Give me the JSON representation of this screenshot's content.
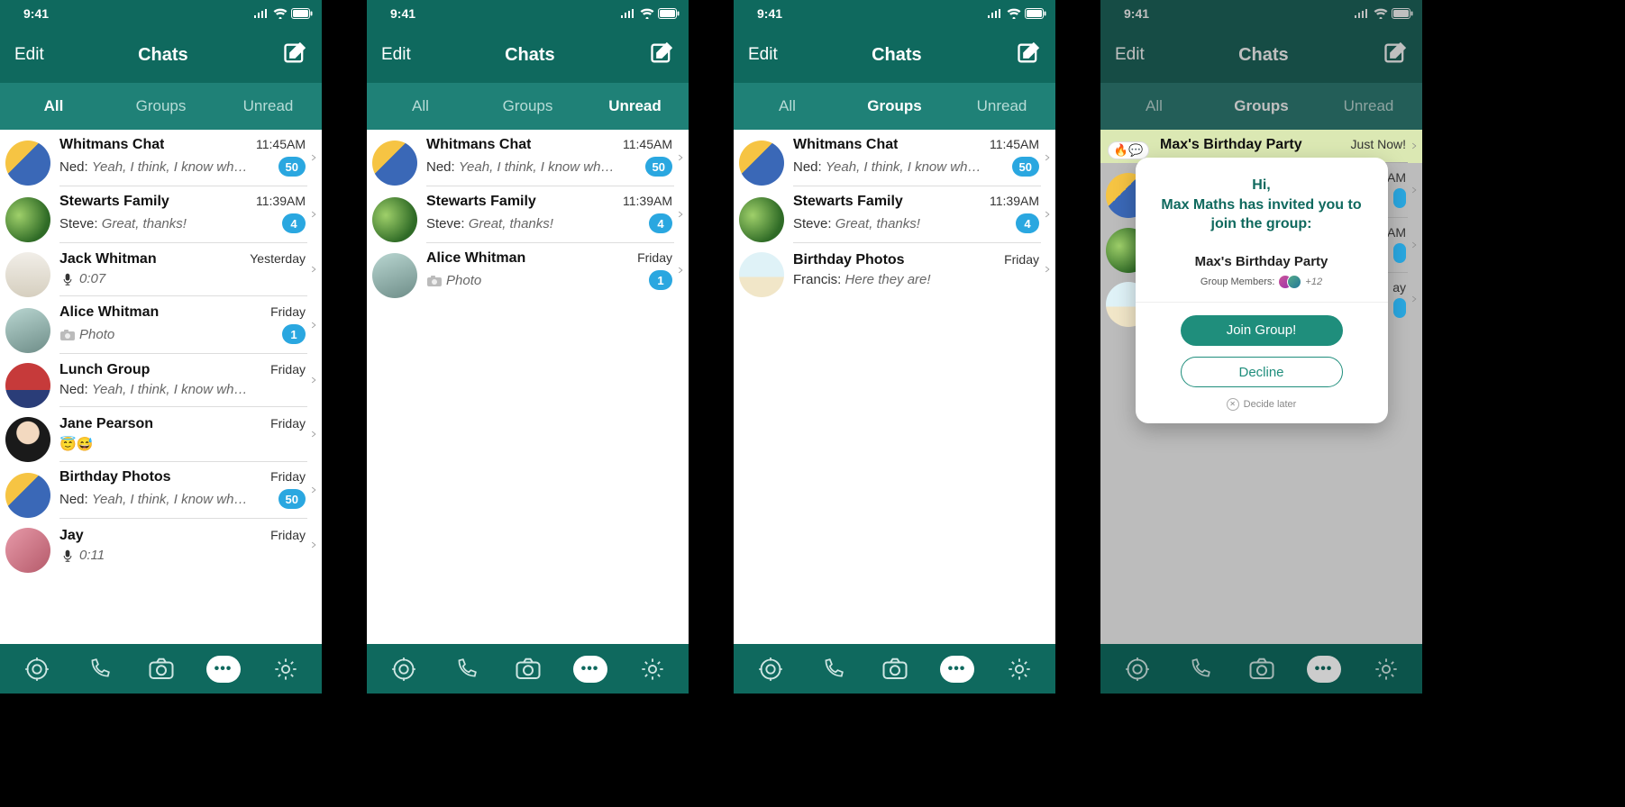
{
  "status": {
    "time": "9:41"
  },
  "header": {
    "edit": "Edit",
    "title": "Chats"
  },
  "tabs": {
    "all": "All",
    "groups": "Groups",
    "unread": "Unread"
  },
  "screens": {
    "all": [
      {
        "name": "Whitmans Chat",
        "time": "11:45AM",
        "sender": "Ned:",
        "body": "Yeah, I think, I know wh…",
        "badge": "50",
        "avatar": "av-train"
      },
      {
        "name": "Stewarts Family",
        "time": "11:39AM",
        "sender": "Steve:",
        "body": "Great, thanks!",
        "badge": "4",
        "avatar": "av-field"
      },
      {
        "name": "Jack Whitman",
        "time": "Yesterday",
        "sender": "",
        "body": "0:07",
        "badge": "",
        "avatar": "av-pipe",
        "voice": true
      },
      {
        "name": "Alice Whitman",
        "time": "Friday",
        "sender": "",
        "body": "Photo",
        "badge": "1",
        "avatar": "av-alice",
        "photo": true
      },
      {
        "name": "Lunch Group",
        "time": "Friday",
        "sender": "Ned:",
        "body": "Yeah, I think, I know wh…",
        "badge": "",
        "avatar": "av-eat"
      },
      {
        "name": "Jane Pearson",
        "time": "Friday",
        "sender": "",
        "body": "😇😅",
        "badge": "",
        "avatar": "av-jane",
        "emoji": true
      },
      {
        "name": "Birthday Photos",
        "time": "Friday",
        "sender": "Ned:",
        "body": "Yeah, I think, I know wh…",
        "badge": "50",
        "avatar": "av-train"
      },
      {
        "name": "Jay",
        "time": "Friday",
        "sender": "",
        "body": "0:11",
        "badge": "",
        "avatar": "av-jay",
        "voice": true
      }
    ],
    "unread": [
      {
        "name": "Whitmans Chat",
        "time": "11:45AM",
        "sender": "Ned:",
        "body": "Yeah, I think, I know wh…",
        "badge": "50",
        "avatar": "av-train"
      },
      {
        "name": "Stewarts Family",
        "time": "11:39AM",
        "sender": "Steve:",
        "body": "Great, thanks!",
        "badge": "4",
        "avatar": "av-field"
      },
      {
        "name": "Alice Whitman",
        "time": "Friday",
        "sender": "",
        "body": "Photo",
        "badge": "1",
        "avatar": "av-alice",
        "photo": true
      }
    ],
    "groups": [
      {
        "name": "Whitmans Chat",
        "time": "11:45AM",
        "sender": "Ned:",
        "body": "Yeah, I think, I know wh…",
        "badge": "50",
        "avatar": "av-train"
      },
      {
        "name": "Stewarts Family",
        "time": "11:39AM",
        "sender": "Steve:",
        "body": "Great, thanks!",
        "badge": "4",
        "avatar": "av-field"
      },
      {
        "name": "Birthday Photos",
        "time": "Friday",
        "sender": "Francis:",
        "body": "Here they are!",
        "badge": "",
        "avatar": "av-beach"
      }
    ],
    "invite_bg": [
      {
        "name": "Max's Birthday Party",
        "time": "Just Now!",
        "avatar": "reactpill",
        "highlight": true
      },
      {
        "name": "",
        "time": "AM",
        "badge": "",
        "avatar": "av-train",
        "partial": true
      },
      {
        "name": "",
        "time": "AM",
        "badge": "",
        "avatar": "av-field",
        "partial": true
      },
      {
        "name": "",
        "time": "ay",
        "badge": "",
        "avatar": "av-beach",
        "partial": true
      }
    ]
  },
  "modal": {
    "hi": "Hi,",
    "line": "Max Maths has invited you to join the group:",
    "group": "Max's Birthday Party",
    "members_label": "Group Members:",
    "members_more": "+12",
    "join": "Join Group!",
    "decline": "Decline",
    "later": "Decide later"
  },
  "reactpill": "🔥💬"
}
